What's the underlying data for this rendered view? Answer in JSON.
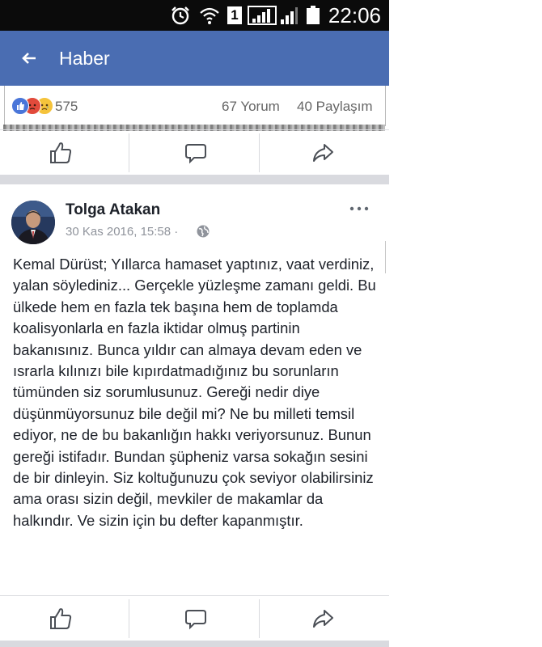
{
  "status_bar": {
    "time": "22:06",
    "sim_badge": "1",
    "icons": [
      "alarm-icon",
      "wifi-icon",
      "sim-badge",
      "signal-icon",
      "signal-icon",
      "battery-icon"
    ]
  },
  "app_bar": {
    "back_icon": "arrow-left-icon",
    "title": "Haber",
    "color": "#4a6db2"
  },
  "previous_post": {
    "reaction_icons": [
      "like-icon",
      "angry-icon",
      "sad-icon"
    ],
    "reaction_count": "575",
    "comments": "67 Yorum",
    "shares": "40 Paylaşım"
  },
  "action_bar_icons": [
    "thumbs-up-icon",
    "comment-icon",
    "share-icon"
  ],
  "post": {
    "author": "Tolga Atakan",
    "date": "30 Kas 2016, 15:58 ·",
    "privacy_icon": "globe-icon",
    "more_icon": "more-icon",
    "body": "Kemal Dürüst; Yıllarca hamaset yaptınız, vaat verdiniz, yalan söylediniz... Gerçekle yüzleşme zamanı geldi. Bu ülkede hem en fazla tek başına hem de toplamda koalisyonlarla en fazla iktidar olmuş partinin bakanısınız. Bunca yıldır can almaya devam eden ve ısrarla kılınızı bile kıpırdatmadığınız bu sorunların tümünden siz sorumlusunuz. Gereği nedir diye düşünmüyorsunuz bile değil mi? Ne bu milleti temsil ediyor, ne de bu bakanlığın hakkı veriyorsunuz. Bunun gereği istifadır. Bundan şüpheniz varsa sokağın sesini de bir dinleyin. Siz koltuğunuzu çok seviyor olabilirsiniz ama orası sizin değil, mevkiler de makamlar da halkındır. Ve sizin için bu defter kapanmıştır."
  }
}
